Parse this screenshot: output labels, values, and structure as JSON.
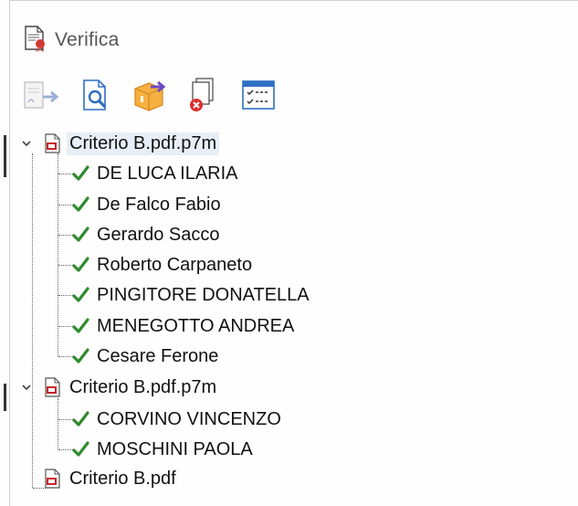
{
  "window": {
    "title": "Verifica",
    "icon": "certified-document-icon"
  },
  "toolbar": {
    "buttons": [
      {
        "icon": "export-signed-doc-icon",
        "state": "disabled"
      },
      {
        "icon": "preview-document-icon",
        "state": "enabled"
      },
      {
        "icon": "extract-package-icon",
        "state": "enabled"
      },
      {
        "icon": "remove-document-icon",
        "state": "enabled"
      },
      {
        "icon": "checklist-report-icon",
        "state": "enabled"
      }
    ]
  },
  "tree": {
    "files": [
      {
        "name": "Criterio B.pdf.p7m",
        "expanded": true,
        "selected": true,
        "signers": [
          "DE LUCA ILARIA",
          "De Falco Fabio",
          "Gerardo Sacco",
          "Roberto Carpaneto",
          "PINGITORE DONATELLA",
          "MENEGOTTO ANDREA",
          "Cesare Ferone"
        ]
      },
      {
        "name": "Criterio B.pdf.p7m",
        "expanded": true,
        "selected": false,
        "signers": [
          "CORVINO VINCENZO",
          "MOSCHINI PAOLA"
        ]
      },
      {
        "name": "Criterio B.pdf",
        "expanded": false,
        "selected": false,
        "signers": []
      }
    ]
  },
  "colors": {
    "check_green": "#2e8b2e",
    "pdf_red": "#c8242b",
    "toolbar_blue": "#2f6fc4",
    "toolbar_orange": "#f0a030"
  }
}
